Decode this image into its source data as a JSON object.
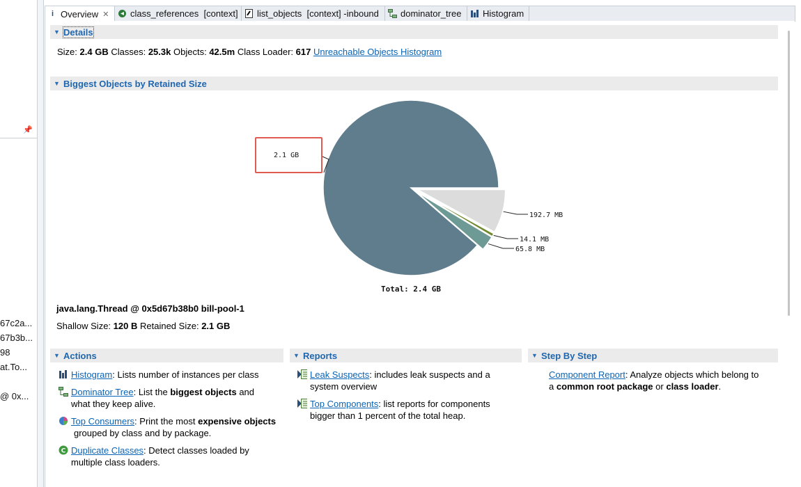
{
  "left_panel": {
    "fragments": [
      "67c2a...",
      "67b3b...",
      "98",
      "at.To...",
      "@ 0x..."
    ]
  },
  "tabs": [
    {
      "label": "Overview",
      "icon": "info-icon",
      "active": true
    },
    {
      "label": "class_references  [context]",
      "icon": "class-ref-icon"
    },
    {
      "label": "list_objects  [context] -inbound",
      "icon": "list-objects-icon"
    },
    {
      "label": "dominator_tree",
      "icon": "dominator-tree-icon"
    },
    {
      "label": "Histogram",
      "icon": "histogram-icon"
    }
  ],
  "details": {
    "title": "Details",
    "size_label": "Size:",
    "size_value": "2.4 GB",
    "classes_label": "Classes:",
    "classes_value": "25.3k",
    "objects_label": "Objects:",
    "objects_value": "42.5m",
    "loader_label": "Class Loader:",
    "loader_value": "617",
    "link": "Unreachable Objects Histogram"
  },
  "biggest": {
    "title": "Biggest Objects by Retained Size"
  },
  "chart_data": {
    "type": "pie",
    "total_label": "Total: 2.4 GB",
    "slices": [
      {
        "label": "2.1 GB",
        "value_gb": 2.1,
        "color": "#5f7d8d"
      },
      {
        "label": "192.7 MB",
        "value_gb": 0.1927,
        "color": "#dcdcdc"
      },
      {
        "label": "14.1 MB",
        "value_gb": 0.0141,
        "color": "#6f8a2e"
      },
      {
        "label": "65.8 MB",
        "value_gb": 0.0658,
        "color": "#6e9a95"
      }
    ],
    "remainder_gb": 0.0274
  },
  "selected_object": {
    "name": "java.lang.Thread @ 0x5d67b38b0 bill-pool-1",
    "shallow_label": "Shallow Size:",
    "shallow_value": "120 B",
    "retained_label": "Retained Size:",
    "retained_value": "2.1 GB"
  },
  "actions": {
    "title": "Actions",
    "items": [
      {
        "link": "Histogram",
        "text": ": Lists number of instances per class"
      },
      {
        "link": "Dominator Tree",
        "text1": ": List the ",
        "bold": "biggest objects",
        "text2": " and",
        "text3": "what they keep alive."
      },
      {
        "link": "Top Consumers",
        "text1": ": Print the most ",
        "bold": "expensive objects",
        "text3": "grouped by class and by package."
      },
      {
        "link": "Duplicate Classes",
        "text": ": Detect classes loaded by",
        "text3": "multiple class loaders."
      }
    ]
  },
  "reports": {
    "title": "Reports",
    "items": [
      {
        "link": "Leak Suspects",
        "text": ": includes leak suspects and a",
        "text2": "system overview"
      },
      {
        "link": "Top Components",
        "text": ": list reports for components",
        "text2": "bigger than 1 percent of the total heap."
      }
    ]
  },
  "steps": {
    "title": "Step By Step",
    "items": [
      {
        "link": "Component Report",
        "text": ": Analyze objects which belong to",
        "text2a": "a ",
        "bold1": "common root package",
        "text2b": " or ",
        "bold2": "class loader",
        "text2c": "."
      }
    ]
  }
}
